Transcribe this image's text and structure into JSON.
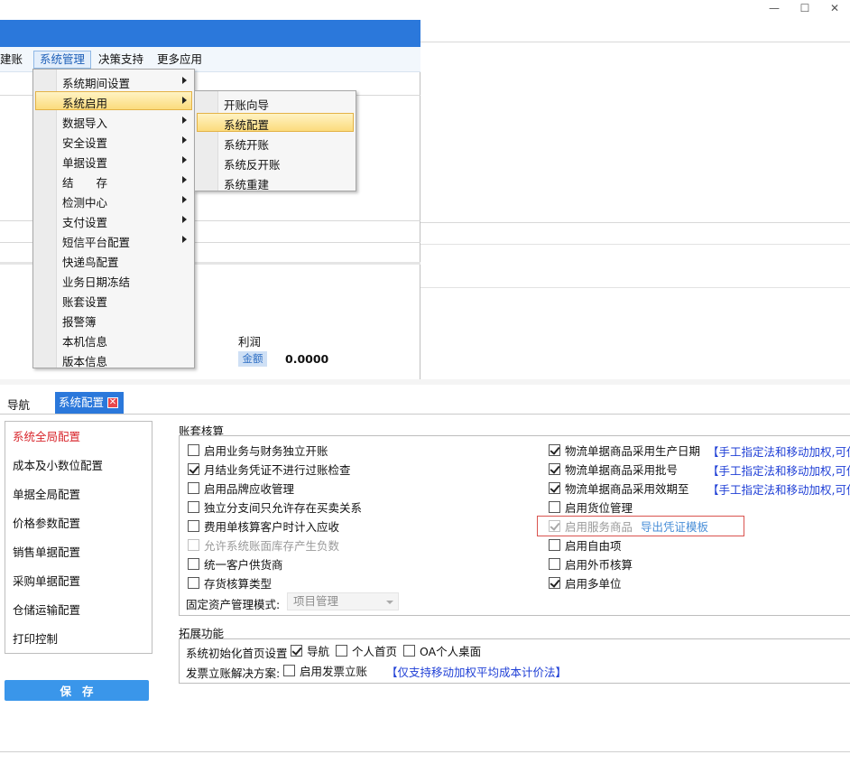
{
  "window_controls": {
    "minimize": "—",
    "maximize": "☐",
    "close": "✕"
  },
  "bg_menubar": [
    {
      "label": "建账",
      "active": false
    },
    {
      "label": "系统管理",
      "active": true
    },
    {
      "label": "决策支持",
      "active": false
    },
    {
      "label": "更多应用",
      "active": false
    }
  ],
  "bg_panel": {
    "profit_label": "利润",
    "amount_badge": "金额",
    "amount_value": "0.0000"
  },
  "menu_system": [
    {
      "label": "系统期间设置",
      "arrow": true
    },
    {
      "label": "系统启用",
      "arrow": true,
      "highlight": true
    },
    {
      "label": "数据导入",
      "arrow": true
    },
    {
      "label": "安全设置",
      "arrow": true
    },
    {
      "label": "单据设置",
      "arrow": true
    },
    {
      "label": "结　　存",
      "arrow": true
    },
    {
      "label": "检测中心",
      "arrow": true
    },
    {
      "label": "支付设置",
      "arrow": true
    },
    {
      "label": "短信平台配置",
      "arrow": true
    },
    {
      "label": "快递鸟配置",
      "arrow": false
    },
    {
      "label": "业务日期冻结",
      "arrow": false
    },
    {
      "label": "账套设置",
      "arrow": false
    },
    {
      "label": "报警簿",
      "arrow": false
    },
    {
      "label": "本机信息",
      "arrow": false
    },
    {
      "label": "版本信息",
      "arrow": false
    }
  ],
  "menu_enable": [
    {
      "label": "开账向导",
      "highlight": false
    },
    {
      "label": "系统配置",
      "highlight": true
    },
    {
      "label": "系统开账",
      "highlight": false
    },
    {
      "label": "系统反开账",
      "highlight": false
    },
    {
      "label": "系统重建",
      "highlight": false
    }
  ],
  "tabs": {
    "nav": "导航",
    "active": "系统配置",
    "close_glyph": "✕"
  },
  "sidebar": [
    {
      "label": "系统全局配置",
      "active": true
    },
    {
      "label": "成本及小数位配置",
      "active": false
    },
    {
      "label": "单据全局配置",
      "active": false
    },
    {
      "label": "价格参数配置",
      "active": false
    },
    {
      "label": "销售单据配置",
      "active": false
    },
    {
      "label": "采购单据配置",
      "active": false
    },
    {
      "label": "仓储运输配置",
      "active": false
    },
    {
      "label": "打印控制",
      "active": false
    }
  ],
  "save_label": "保存",
  "accounting": {
    "title": "账套核算",
    "left": [
      {
        "label": "启用业务与财务独立开账",
        "checked": false,
        "disabled": false
      },
      {
        "label": "月结业务凭证不进行过账检查",
        "checked": true,
        "disabled": false
      },
      {
        "label": "启用品牌应收管理",
        "checked": false,
        "disabled": false
      },
      {
        "label": "独立分支间只允许存在买卖关系",
        "checked": false,
        "disabled": false
      },
      {
        "label": "费用单核算客户时计入应收",
        "checked": false,
        "disabled": false
      },
      {
        "label": "允许系统账面库存产生负数",
        "checked": false,
        "disabled": true
      },
      {
        "label": "统一客户供货商",
        "checked": false,
        "disabled": false
      },
      {
        "label": "存货核算类型",
        "checked": false,
        "disabled": false
      }
    ],
    "right": [
      {
        "label": "物流单据商品采用生产日期",
        "checked": true,
        "disabled": false,
        "note": "【手工指定法和移动加权,可使"
      },
      {
        "label": "物流单据商品采用批号",
        "checked": true,
        "disabled": false,
        "note": "【手工指定法和移动加权,可使"
      },
      {
        "label": "物流单据商品采用效期至",
        "checked": true,
        "disabled": false,
        "note": "【手工指定法和移动加权,可使"
      },
      {
        "label": "启用货位管理",
        "checked": false,
        "disabled": false
      },
      {
        "label": "启用服务商品",
        "checked": true,
        "disabled": true,
        "link": "导出凭证模板"
      },
      {
        "label": "启用自由项",
        "checked": false,
        "disabled": false
      },
      {
        "label": "启用外币核算",
        "checked": false,
        "disabled": false
      },
      {
        "label": "启用多单位",
        "checked": true,
        "disabled": false
      }
    ],
    "asset_mode_label": "固定资产管理模式:",
    "asset_mode_value": "项目管理"
  },
  "extension": {
    "title": "拓展功能",
    "homepage_label": "系统初始化首页设置",
    "homepage_options": [
      {
        "label": "导航",
        "checked": true
      },
      {
        "label": "个人首页",
        "checked": false
      },
      {
        "label": "OA个人桌面",
        "checked": false
      }
    ],
    "invoice_label": "发票立账解决方案:",
    "invoice_option": {
      "label": "启用发票立账",
      "checked": false
    },
    "invoice_note": "【仅支持移动加权平均成本计价法】"
  }
}
